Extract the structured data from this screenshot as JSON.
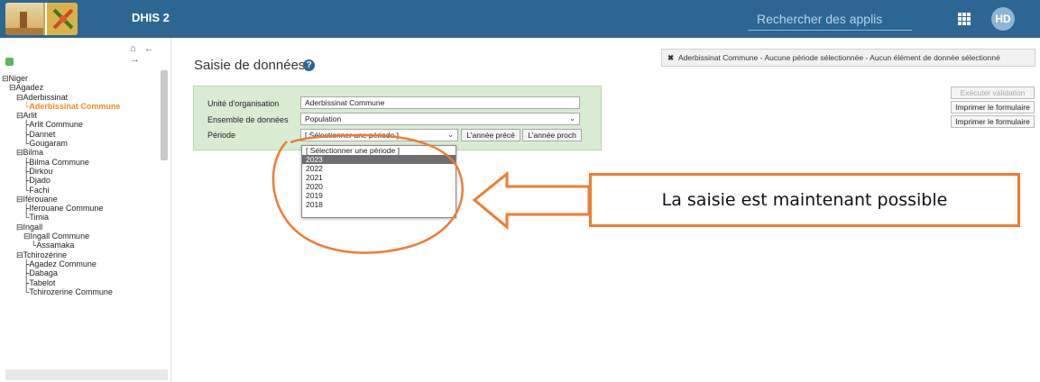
{
  "header": {
    "app_title": "DHIS 2",
    "search_placeholder": "Rechercher des applis",
    "avatar_initials": "HD",
    "background": "#2c6693"
  },
  "sidebar": {
    "nav_glyphs": "⌂ ← →",
    "tree": [
      {
        "label": "Niger",
        "depth": 0,
        "marker": "⊟"
      },
      {
        "label": "Agadez",
        "depth": 1,
        "marker": "⊟"
      },
      {
        "label": "Aderbissinat",
        "depth": 2,
        "marker": "⊟"
      },
      {
        "label": "Aderbissinat Commune",
        "depth": 3,
        "marker": "└",
        "selected": true
      },
      {
        "label": "Arlit",
        "depth": 2,
        "marker": "⊟"
      },
      {
        "label": "Arlit Commune",
        "depth": 3,
        "marker": "├"
      },
      {
        "label": "Dannet",
        "depth": 3,
        "marker": "├"
      },
      {
        "label": "Gougaram",
        "depth": 3,
        "marker": "└"
      },
      {
        "label": "Bilma",
        "depth": 2,
        "marker": "⊟"
      },
      {
        "label": "Bilma Commune",
        "depth": 3,
        "marker": "├"
      },
      {
        "label": "Dirkou",
        "depth": 3,
        "marker": "├"
      },
      {
        "label": "Djado",
        "depth": 3,
        "marker": "├"
      },
      {
        "label": "Fachi",
        "depth": 3,
        "marker": "└"
      },
      {
        "label": "Iférouane",
        "depth": 2,
        "marker": "⊟"
      },
      {
        "label": "Iferouane Commune",
        "depth": 3,
        "marker": "├"
      },
      {
        "label": "Timia",
        "depth": 3,
        "marker": "└"
      },
      {
        "label": "Ingall",
        "depth": 2,
        "marker": "⊟"
      },
      {
        "label": "Ingall Commune",
        "depth": 3,
        "marker": "⊟"
      },
      {
        "label": "Assamaka",
        "depth": 4,
        "marker": "└"
      },
      {
        "label": "Tchirozérine",
        "depth": 2,
        "marker": "⊟"
      },
      {
        "label": "Agadez Commune",
        "depth": 3,
        "marker": "├"
      },
      {
        "label": "Dabaga",
        "depth": 3,
        "marker": "├"
      },
      {
        "label": "Tabelot",
        "depth": 3,
        "marker": "├"
      },
      {
        "label": "Tchirozerine Commune",
        "depth": 3,
        "marker": "└"
      }
    ]
  },
  "main": {
    "page_title": "Saisie de données",
    "help_glyph": "?",
    "status": {
      "close_glyph": "✖",
      "text": "Aderbissinat Commune - Aucune période sélectionnée - Aucun élément de donnée sélectionné"
    },
    "side_buttons": {
      "validate": "Exécuter validation",
      "print1": "Imprimer le formulaire",
      "print2": "Imprimer le formulaire"
    },
    "form": {
      "org_unit_label": "Unité d'organisation",
      "org_unit_value": "Aderbissinat Commune",
      "dataset_label": "Ensemble de données",
      "dataset_value": "Population",
      "period_label": "Période",
      "period_value": "[ Sélectionner une période ]",
      "prev_year": "L'année précé",
      "next_year": "L'année proch"
    },
    "period_options": [
      "[ Sélectionner une période ]",
      "2023",
      "2022",
      "2021",
      "2020",
      "2019",
      "2018"
    ],
    "period_highlighted": "2023"
  },
  "annotation": {
    "callout_text": "La saisie est maintenant possible",
    "accent_color": "#ed7d31"
  }
}
